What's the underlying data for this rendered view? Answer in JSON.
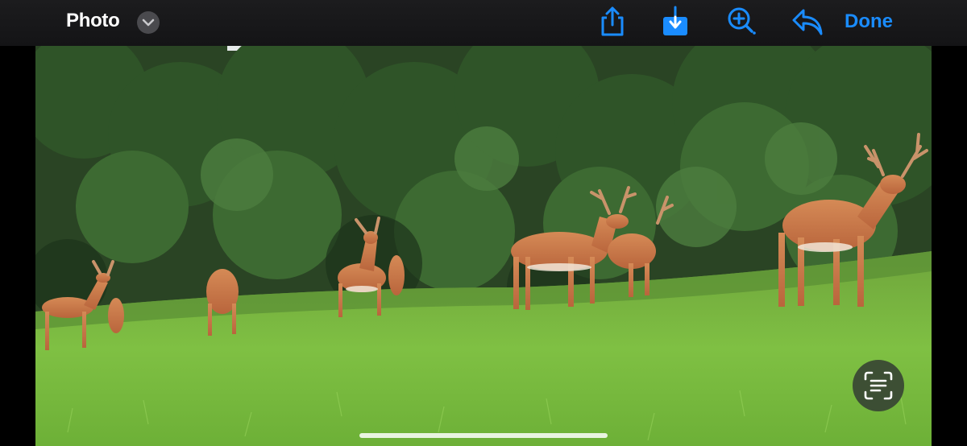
{
  "header": {
    "title": "Photo",
    "done_label": "Done",
    "accent_color": "#1a8cff",
    "icons": [
      "chevron-down-icon",
      "share-icon",
      "download-icon",
      "zoom-in-icon",
      "reply-icon"
    ]
  },
  "photo": {
    "subject": "trail-camera-photo",
    "overlay_icon": "live-text-icon"
  }
}
